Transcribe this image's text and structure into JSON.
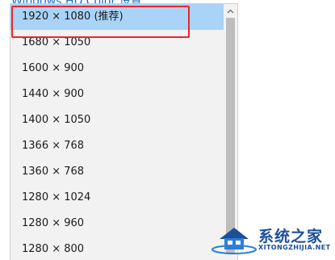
{
  "background_link": {
    "text": "Windows HD Color 设置"
  },
  "dropdown": {
    "items": [
      {
        "label": "1920 × 1080 (推荐)",
        "selected": true
      },
      {
        "label": "1680 × 1050",
        "selected": false
      },
      {
        "label": "1600 × 900",
        "selected": false
      },
      {
        "label": "1440 × 900",
        "selected": false
      },
      {
        "label": "1400 × 1050",
        "selected": false
      },
      {
        "label": "1366 × 768",
        "selected": false
      },
      {
        "label": "1360 × 768",
        "selected": false
      },
      {
        "label": "1280 × 1024",
        "selected": false
      },
      {
        "label": "1280 × 960",
        "selected": false
      },
      {
        "label": "1280 × 800",
        "selected": false
      }
    ],
    "selected_color": "#a9d3f7",
    "scroll_up_icon": "chevron-up-icon"
  },
  "annotation": {
    "color": "#e8262c"
  },
  "watermark": {
    "title": "系统之家",
    "subtitle": "XITONGZHIJIA.NET"
  }
}
